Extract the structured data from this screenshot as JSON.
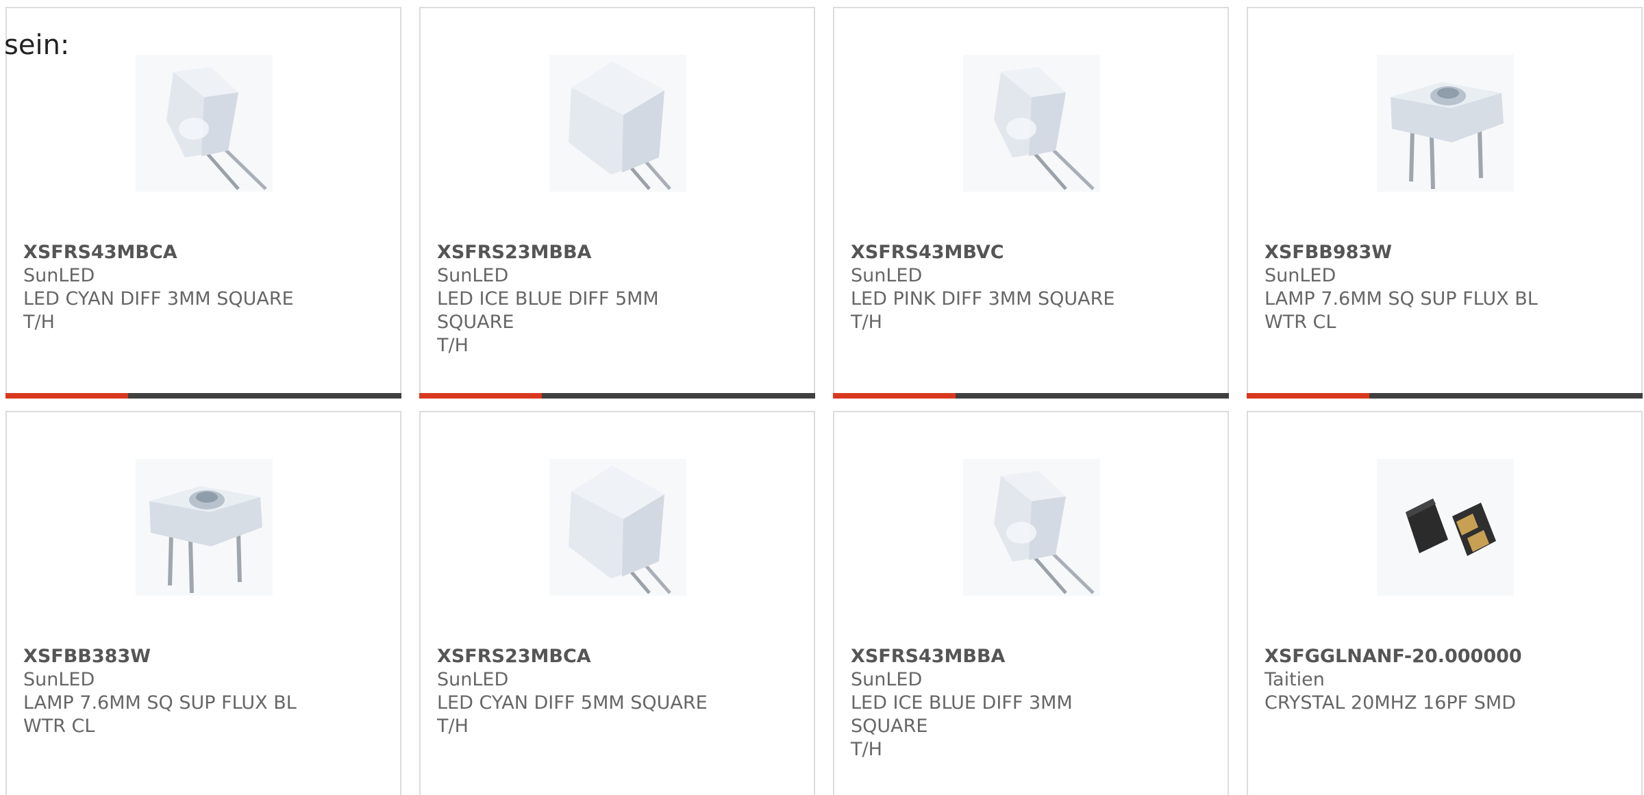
{
  "intro": {
    "text": "sein:"
  },
  "colors": {
    "accent": "#d9381e",
    "bar": "#404040",
    "border": "#dcdcdc",
    "text": "#666666"
  },
  "products": [
    {
      "part": "XSFRS43MBCA",
      "maker": "SunLED",
      "desc_line1": "LED CYAN DIFF 3MM SQUARE",
      "desc_line2": "T/H",
      "image": "square-led-3mm",
      "accent_progress": 0.31
    },
    {
      "part": "XSFRS23MBBA",
      "maker": "SunLED",
      "desc_line1": "LED ICE BLUE DIFF 5MM SQUARE",
      "desc_line2": "T/H",
      "image": "square-led-5mm",
      "accent_progress": 0.31
    },
    {
      "part": "XSFRS43MBVC",
      "maker": "SunLED",
      "desc_line1": "LED PINK DIFF 3MM SQUARE T/H",
      "desc_line2": "",
      "image": "square-led-3mm",
      "accent_progress": 0.31
    },
    {
      "part": "XSFBB983W",
      "maker": "SunLED",
      "desc_line1": "LAMP 7.6MM SQ SUP FLUX BL",
      "desc_line2": "WTR CL",
      "image": "flux-led-lamp",
      "accent_progress": 0.31
    },
    {
      "part": "XSFBB383W",
      "maker": "SunLED",
      "desc_line1": "LAMP 7.6MM SQ SUP FLUX BL",
      "desc_line2": "WTR CL",
      "image": "flux-led-lamp",
      "accent_progress": 0
    },
    {
      "part": "XSFRS23MBCA",
      "maker": "SunLED",
      "desc_line1": "LED CYAN DIFF 5MM SQUARE",
      "desc_line2": "T/H",
      "image": "square-led-5mm",
      "accent_progress": 0
    },
    {
      "part": "XSFRS43MBBA",
      "maker": "SunLED",
      "desc_line1": "LED ICE BLUE DIFF 3MM SQUARE",
      "desc_line2": "T/H",
      "image": "square-led-3mm",
      "accent_progress": 0
    },
    {
      "part": "XSFGGLNANF-20.000000",
      "maker": "Taitien",
      "desc_line1": "CRYSTAL 20MHZ 16PF SMD",
      "desc_line2": "",
      "image": "smd-crystal",
      "accent_progress": 0
    }
  ]
}
